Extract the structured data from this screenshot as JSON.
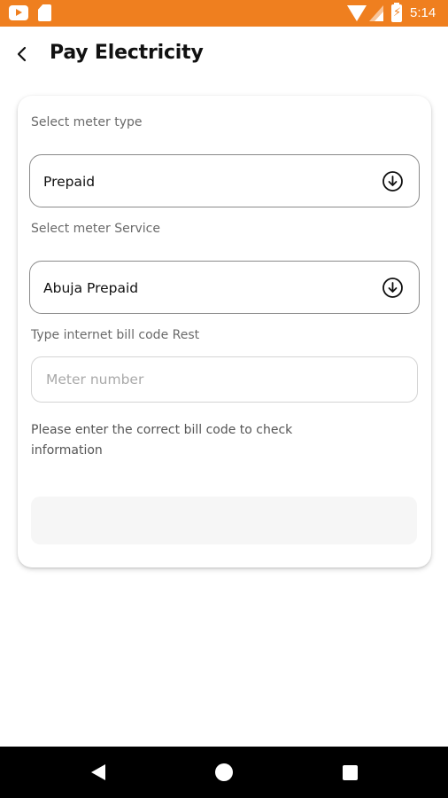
{
  "status_bar": {
    "time": "5:14",
    "icons": [
      "youtube-icon",
      "sd-card-icon",
      "wifi-icon",
      "signal-icon",
      "battery-charging-icon"
    ]
  },
  "header": {
    "title": "Pay Electricity",
    "back_icon": "chevron-left-icon"
  },
  "form": {
    "meter_type": {
      "label": "Select meter type",
      "value": "Prepaid",
      "icon": "download-circle-icon"
    },
    "meter_service": {
      "label": "Select meter Service",
      "value": "Abuja Prepaid",
      "icon": "download-circle-icon"
    },
    "bill_code": {
      "label": "Type internet bill code Rest",
      "value": "",
      "placeholder": "Meter number"
    },
    "hint": "Please enter the correct bill code to check information",
    "submit_label": ""
  },
  "nav_bar": {
    "icons": [
      "nav-back-icon",
      "nav-home-icon",
      "nav-recents-icon"
    ]
  },
  "colors": {
    "status_bar": "#ef7f1f",
    "text_primary": "#111111",
    "text_label": "#6a6a6a",
    "border_select": "#8a8a8a",
    "border_input": "#d4d4d4",
    "button_disabled": "#f6f6f6"
  }
}
